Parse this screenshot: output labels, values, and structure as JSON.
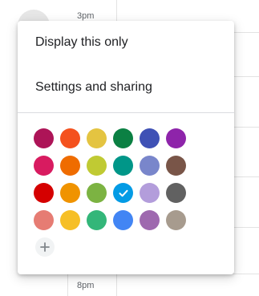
{
  "background": {
    "time_top": "3pm",
    "time_bottom": "8pm"
  },
  "menu": {
    "items": [
      {
        "label": "Display this only"
      },
      {
        "label": "Settings and sharing"
      }
    ]
  },
  "palette": {
    "selected_index": 15,
    "colors": [
      "#ad1457",
      "#f4511e",
      "#e4c441",
      "#0b8043",
      "#3f51b5",
      "#8e24aa",
      "#d81b60",
      "#ef6c00",
      "#c0ca33",
      "#009688",
      "#7986cb",
      "#795548",
      "#d50000",
      "#f09300",
      "#7cb342",
      "#039be5",
      "#b39ddb",
      "#616161",
      "#e67c73",
      "#f6bf26",
      "#33b679",
      "#4285f4",
      "#9e69af",
      "#a79b8e"
    ],
    "add_icon": "plus-icon",
    "check_icon": "check-icon"
  }
}
